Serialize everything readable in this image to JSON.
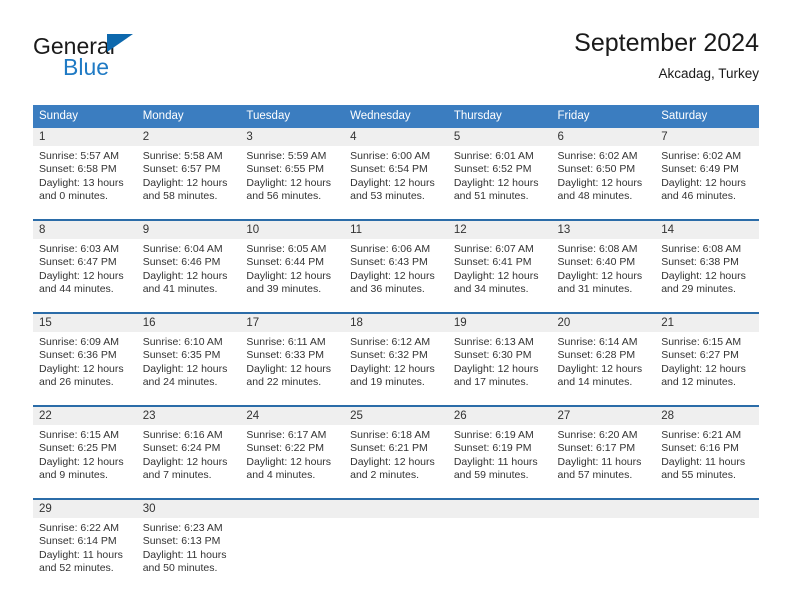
{
  "brand": {
    "word1": "General",
    "word2": "Blue",
    "flag_icon": "triangle-flag-icon",
    "accent_color": "#1f7ac4"
  },
  "header": {
    "month_title": "September 2024",
    "location": "Akcadag, Turkey"
  },
  "calendar": {
    "header_bg": "#3b7dc0",
    "row_divider_color": "#2b6ca8",
    "day_band_bg": "#efefef",
    "day_names": [
      "Sunday",
      "Monday",
      "Tuesday",
      "Wednesday",
      "Thursday",
      "Friday",
      "Saturday"
    ],
    "weeks": [
      [
        {
          "day": "1",
          "sunrise": "Sunrise: 5:57 AM",
          "sunset": "Sunset: 6:58 PM",
          "daylight1": "Daylight: 13 hours",
          "daylight2": "and 0 minutes."
        },
        {
          "day": "2",
          "sunrise": "Sunrise: 5:58 AM",
          "sunset": "Sunset: 6:57 PM",
          "daylight1": "Daylight: 12 hours",
          "daylight2": "and 58 minutes."
        },
        {
          "day": "3",
          "sunrise": "Sunrise: 5:59 AM",
          "sunset": "Sunset: 6:55 PM",
          "daylight1": "Daylight: 12 hours",
          "daylight2": "and 56 minutes."
        },
        {
          "day": "4",
          "sunrise": "Sunrise: 6:00 AM",
          "sunset": "Sunset: 6:54 PM",
          "daylight1": "Daylight: 12 hours",
          "daylight2": "and 53 minutes."
        },
        {
          "day": "5",
          "sunrise": "Sunrise: 6:01 AM",
          "sunset": "Sunset: 6:52 PM",
          "daylight1": "Daylight: 12 hours",
          "daylight2": "and 51 minutes."
        },
        {
          "day": "6",
          "sunrise": "Sunrise: 6:02 AM",
          "sunset": "Sunset: 6:50 PM",
          "daylight1": "Daylight: 12 hours",
          "daylight2": "and 48 minutes."
        },
        {
          "day": "7",
          "sunrise": "Sunrise: 6:02 AM",
          "sunset": "Sunset: 6:49 PM",
          "daylight1": "Daylight: 12 hours",
          "daylight2": "and 46 minutes."
        }
      ],
      [
        {
          "day": "8",
          "sunrise": "Sunrise: 6:03 AM",
          "sunset": "Sunset: 6:47 PM",
          "daylight1": "Daylight: 12 hours",
          "daylight2": "and 44 minutes."
        },
        {
          "day": "9",
          "sunrise": "Sunrise: 6:04 AM",
          "sunset": "Sunset: 6:46 PM",
          "daylight1": "Daylight: 12 hours",
          "daylight2": "and 41 minutes."
        },
        {
          "day": "10",
          "sunrise": "Sunrise: 6:05 AM",
          "sunset": "Sunset: 6:44 PM",
          "daylight1": "Daylight: 12 hours",
          "daylight2": "and 39 minutes."
        },
        {
          "day": "11",
          "sunrise": "Sunrise: 6:06 AM",
          "sunset": "Sunset: 6:43 PM",
          "daylight1": "Daylight: 12 hours",
          "daylight2": "and 36 minutes."
        },
        {
          "day": "12",
          "sunrise": "Sunrise: 6:07 AM",
          "sunset": "Sunset: 6:41 PM",
          "daylight1": "Daylight: 12 hours",
          "daylight2": "and 34 minutes."
        },
        {
          "day": "13",
          "sunrise": "Sunrise: 6:08 AM",
          "sunset": "Sunset: 6:40 PM",
          "daylight1": "Daylight: 12 hours",
          "daylight2": "and 31 minutes."
        },
        {
          "day": "14",
          "sunrise": "Sunrise: 6:08 AM",
          "sunset": "Sunset: 6:38 PM",
          "daylight1": "Daylight: 12 hours",
          "daylight2": "and 29 minutes."
        }
      ],
      [
        {
          "day": "15",
          "sunrise": "Sunrise: 6:09 AM",
          "sunset": "Sunset: 6:36 PM",
          "daylight1": "Daylight: 12 hours",
          "daylight2": "and 26 minutes."
        },
        {
          "day": "16",
          "sunrise": "Sunrise: 6:10 AM",
          "sunset": "Sunset: 6:35 PM",
          "daylight1": "Daylight: 12 hours",
          "daylight2": "and 24 minutes."
        },
        {
          "day": "17",
          "sunrise": "Sunrise: 6:11 AM",
          "sunset": "Sunset: 6:33 PM",
          "daylight1": "Daylight: 12 hours",
          "daylight2": "and 22 minutes."
        },
        {
          "day": "18",
          "sunrise": "Sunrise: 6:12 AM",
          "sunset": "Sunset: 6:32 PM",
          "daylight1": "Daylight: 12 hours",
          "daylight2": "and 19 minutes."
        },
        {
          "day": "19",
          "sunrise": "Sunrise: 6:13 AM",
          "sunset": "Sunset: 6:30 PM",
          "daylight1": "Daylight: 12 hours",
          "daylight2": "and 17 minutes."
        },
        {
          "day": "20",
          "sunrise": "Sunrise: 6:14 AM",
          "sunset": "Sunset: 6:28 PM",
          "daylight1": "Daylight: 12 hours",
          "daylight2": "and 14 minutes."
        },
        {
          "day": "21",
          "sunrise": "Sunrise: 6:15 AM",
          "sunset": "Sunset: 6:27 PM",
          "daylight1": "Daylight: 12 hours",
          "daylight2": "and 12 minutes."
        }
      ],
      [
        {
          "day": "22",
          "sunrise": "Sunrise: 6:15 AM",
          "sunset": "Sunset: 6:25 PM",
          "daylight1": "Daylight: 12 hours",
          "daylight2": "and 9 minutes."
        },
        {
          "day": "23",
          "sunrise": "Sunrise: 6:16 AM",
          "sunset": "Sunset: 6:24 PM",
          "daylight1": "Daylight: 12 hours",
          "daylight2": "and 7 minutes."
        },
        {
          "day": "24",
          "sunrise": "Sunrise: 6:17 AM",
          "sunset": "Sunset: 6:22 PM",
          "daylight1": "Daylight: 12 hours",
          "daylight2": "and 4 minutes."
        },
        {
          "day": "25",
          "sunrise": "Sunrise: 6:18 AM",
          "sunset": "Sunset: 6:21 PM",
          "daylight1": "Daylight: 12 hours",
          "daylight2": "and 2 minutes."
        },
        {
          "day": "26",
          "sunrise": "Sunrise: 6:19 AM",
          "sunset": "Sunset: 6:19 PM",
          "daylight1": "Daylight: 11 hours",
          "daylight2": "and 59 minutes."
        },
        {
          "day": "27",
          "sunrise": "Sunrise: 6:20 AM",
          "sunset": "Sunset: 6:17 PM",
          "daylight1": "Daylight: 11 hours",
          "daylight2": "and 57 minutes."
        },
        {
          "day": "28",
          "sunrise": "Sunrise: 6:21 AM",
          "sunset": "Sunset: 6:16 PM",
          "daylight1": "Daylight: 11 hours",
          "daylight2": "and 55 minutes."
        }
      ],
      [
        {
          "day": "29",
          "sunrise": "Sunrise: 6:22 AM",
          "sunset": "Sunset: 6:14 PM",
          "daylight1": "Daylight: 11 hours",
          "daylight2": "and 52 minutes."
        },
        {
          "day": "30",
          "sunrise": "Sunrise: 6:23 AM",
          "sunset": "Sunset: 6:13 PM",
          "daylight1": "Daylight: 11 hours",
          "daylight2": "and 50 minutes."
        },
        {
          "day": "",
          "sunrise": "",
          "sunset": "",
          "daylight1": "",
          "daylight2": ""
        },
        {
          "day": "",
          "sunrise": "",
          "sunset": "",
          "daylight1": "",
          "daylight2": ""
        },
        {
          "day": "",
          "sunrise": "",
          "sunset": "",
          "daylight1": "",
          "daylight2": ""
        },
        {
          "day": "",
          "sunrise": "",
          "sunset": "",
          "daylight1": "",
          "daylight2": ""
        },
        {
          "day": "",
          "sunrise": "",
          "sunset": "",
          "daylight1": "",
          "daylight2": ""
        }
      ]
    ]
  }
}
